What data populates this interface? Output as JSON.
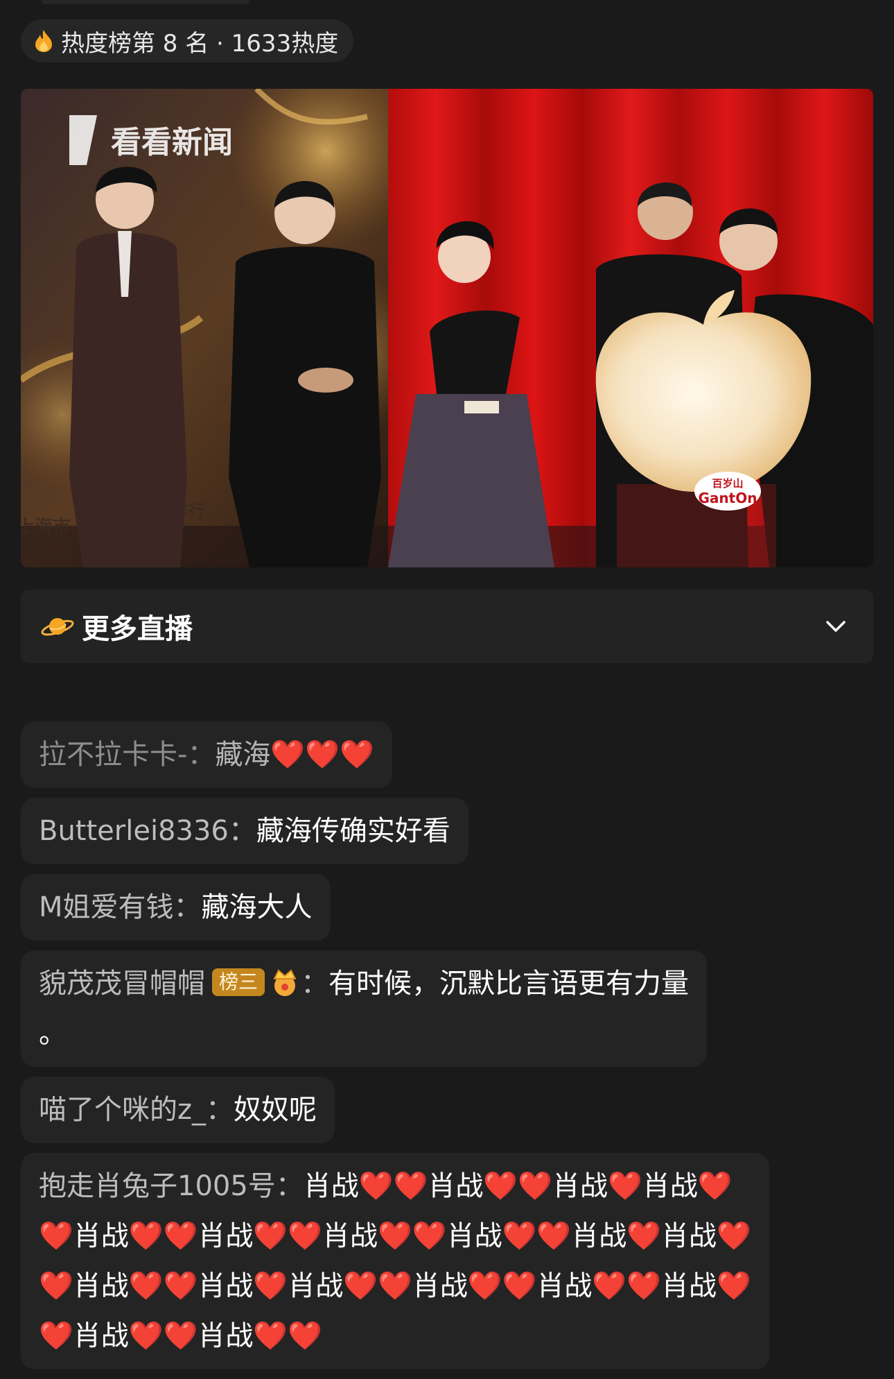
{
  "hot_badge": {
    "text": "热度榜第 8 名 · 1633热度",
    "icon": "flame-icon"
  },
  "video": {
    "watermark": "看看新闻",
    "sponsor_top": "百岁山",
    "sponsor_bottom": "GantOn",
    "banner_partial": "作行",
    "banner_left": "上海市"
  },
  "more_live": {
    "label": "更多直播",
    "icon": "planet-icon",
    "toggle_icon": "chevron-down-icon"
  },
  "comments": [
    {
      "user": "拉不拉卡卡-",
      "sep": "：",
      "message": "藏海❤️❤️❤️",
      "faded": true
    },
    {
      "user": "Butterlei8336",
      "sep": "：",
      "message": "藏海传确实好看"
    },
    {
      "user": "M姐爱有钱",
      "sep": "：",
      "message": "藏海大人"
    },
    {
      "user": "貌茂茂冒帽帽",
      "badge": "榜三",
      "badge_icon": "crown-icon",
      "sep": "：",
      "message": "有时候，沉默比言语更有力量 。"
    },
    {
      "user": "喵了个咪的z_",
      "sep": "：",
      "message": "奴奴呢"
    },
    {
      "user": "抱走肖兔子1005号",
      "sep": "：",
      "message": "肖战❤️❤️肖战❤️❤️肖战❤️肖战❤️❤️肖战❤️❤️肖战❤️❤️肖战❤️❤️肖战❤️❤️肖战❤️肖战❤️❤️肖战❤️❤️肖战❤️肖战❤️❤️肖战❤️❤️肖战❤️❤️肖战❤️❤️肖战❤️❤️肖战❤️❤️"
    }
  ]
}
